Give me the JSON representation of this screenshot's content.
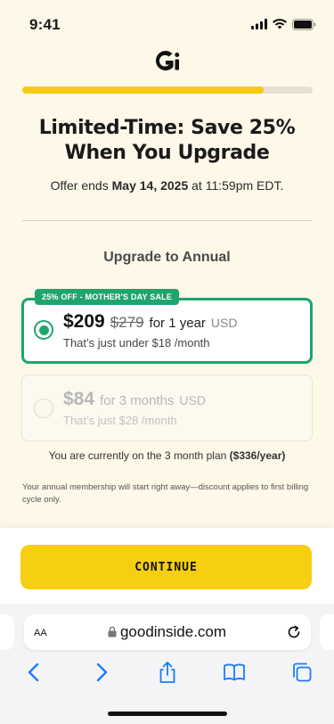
{
  "status": {
    "time": "9:41"
  },
  "progress": {
    "fraction": 0.83
  },
  "headline": {
    "line1": "Limited-Time: Save 25%",
    "line2": "When You Upgrade"
  },
  "offer": {
    "prefix": "Offer ends",
    "date": "May 14, 2025",
    "suffix": "at 11:59pm EDT."
  },
  "section": {
    "title": "Upgrade to Annual"
  },
  "plans": [
    {
      "badge": "25% OFF - MOTHER'S DAY SALE",
      "price": "$209",
      "old_price": "$279",
      "term": "for 1 year",
      "currency": "USD",
      "subline": "That’s just under $18 /month",
      "selected": true
    },
    {
      "price": "$84",
      "term": "for 3 months",
      "currency": "USD",
      "subline": "That’s just $28 /month",
      "selected": false
    }
  ],
  "current_plan": {
    "text": "You are currently on the 3 month plan",
    "bold": "($336/year)"
  },
  "disclaimer": "Your annual membership will start right away—discount applies to first billing cycle only.",
  "cta": {
    "label": "CONTINUE"
  },
  "browser": {
    "aa_label": "AA",
    "url": "goodinside.com"
  },
  "colors": {
    "accent_green": "#1fa56c",
    "cta_yellow": "#f6cf12",
    "safari_blue": "#1a7cf5"
  },
  "icons": [
    "signal-icon",
    "wifi-icon",
    "battery-icon",
    "logo-icon",
    "lock-icon",
    "reload-icon",
    "back-icon",
    "forward-icon",
    "share-icon",
    "bookmarks-icon",
    "tabs-icon"
  ]
}
